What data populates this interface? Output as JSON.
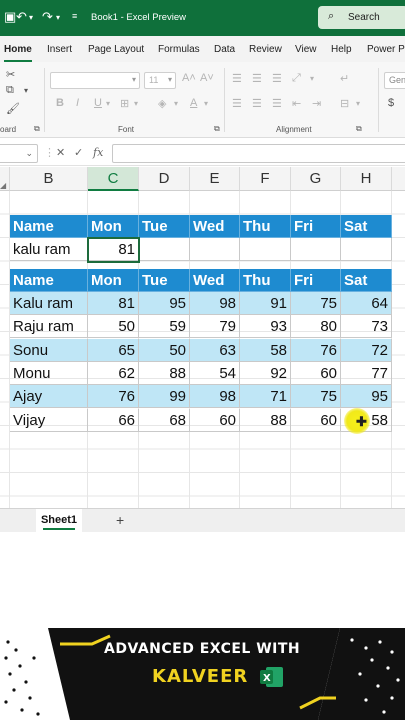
{
  "titlebar": {
    "doc_title": "Book1  -  Excel Preview",
    "search_label": "Search"
  },
  "ribbon_tabs": [
    "Home",
    "Insert",
    "Page Layout",
    "Formulas",
    "Data",
    "Review",
    "View",
    "Help",
    "Power Pi"
  ],
  "ribbon": {
    "font_size": "11",
    "font_name": "",
    "font_group_label": "Font",
    "alignment_group_label": "Alignment",
    "clipboard_group_label": "oard",
    "general_label": "Gen"
  },
  "formula_bar": {
    "fx_label": "fx"
  },
  "columns": [
    "B",
    "C",
    "D",
    "E",
    "F",
    "G",
    "H"
  ],
  "selected_column": "C",
  "table1": {
    "headers": [
      "Name",
      "Mon",
      "Tue",
      "Wed",
      "Thu",
      "Fri",
      "Sat"
    ],
    "row": [
      "kalu ram",
      "81",
      "",
      "",
      "",
      "",
      ""
    ]
  },
  "table2": {
    "headers": [
      "Name",
      "Mon",
      "Tue",
      "Wed",
      "Thu",
      "Fri",
      "Sat"
    ],
    "rows": [
      [
        "Kalu ram",
        "81",
        "95",
        "98",
        "91",
        "75",
        "64"
      ],
      [
        "Raju ram",
        "50",
        "59",
        "79",
        "93",
        "80",
        "73"
      ],
      [
        "Sonu",
        "65",
        "50",
        "63",
        "58",
        "76",
        "72"
      ],
      [
        "Monu",
        "62",
        "88",
        "54",
        "92",
        "60",
        "77"
      ],
      [
        "Ajay",
        "76",
        "99",
        "98",
        "71",
        "75",
        "95"
      ],
      [
        "Vijay",
        "66",
        "68",
        "60",
        "88",
        "60",
        "58"
      ]
    ]
  },
  "sheet_tabs": {
    "active": "Sheet1",
    "add_label": "+"
  },
  "banner": {
    "line1": "ADVANCED EXCEL WITH",
    "line2": "KALVEER",
    "badge": "X"
  },
  "colors": {
    "title_green": "#0f703b",
    "header_blue": "#1e8bd0",
    "band_blue": "#bfe6f6",
    "accent_green": "#107c41",
    "banner_yellow": "#f0d220"
  }
}
